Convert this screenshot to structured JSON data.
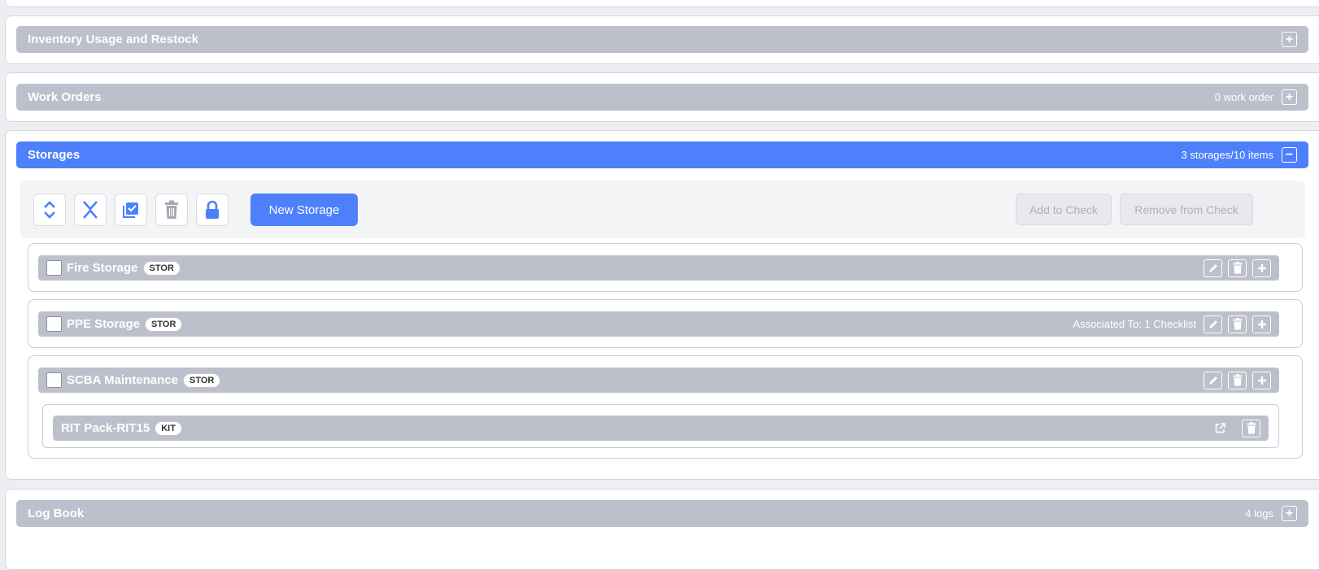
{
  "sections": {
    "inventory": {
      "title": "Inventory Usage and Restock",
      "toggle": "+"
    },
    "work_orders": {
      "title": "Work Orders",
      "count": "0 work order",
      "toggle": "+"
    },
    "storages": {
      "title": "Storages",
      "count": "3 storages/10 items",
      "toggle": "−"
    },
    "log_book": {
      "title": "Log Book",
      "count": "4 logs",
      "toggle": "+"
    }
  },
  "toolbar": {
    "new_storage": "New Storage",
    "add_to_check": "Add to Check",
    "remove_from_check": "Remove from Check",
    "icons": [
      "expand-all-icon",
      "collapse-all-icon",
      "select-all-icon",
      "trash-icon",
      "lock-icon"
    ]
  },
  "storage_rows": [
    {
      "name": "Fire Storage",
      "tag": "STOR",
      "associated": ""
    },
    {
      "name": "PPE Storage",
      "tag": "STOR",
      "associated": "Associated To: 1 Checklist"
    },
    {
      "name": "SCBA Maintenance",
      "tag": "STOR",
      "associated": ""
    }
  ],
  "kit_row": {
    "name": "RIT Pack-RIT15",
    "tag": "KIT"
  },
  "colors": {
    "accent": "#4e80fb",
    "section_bar": "#bcc0ca"
  }
}
